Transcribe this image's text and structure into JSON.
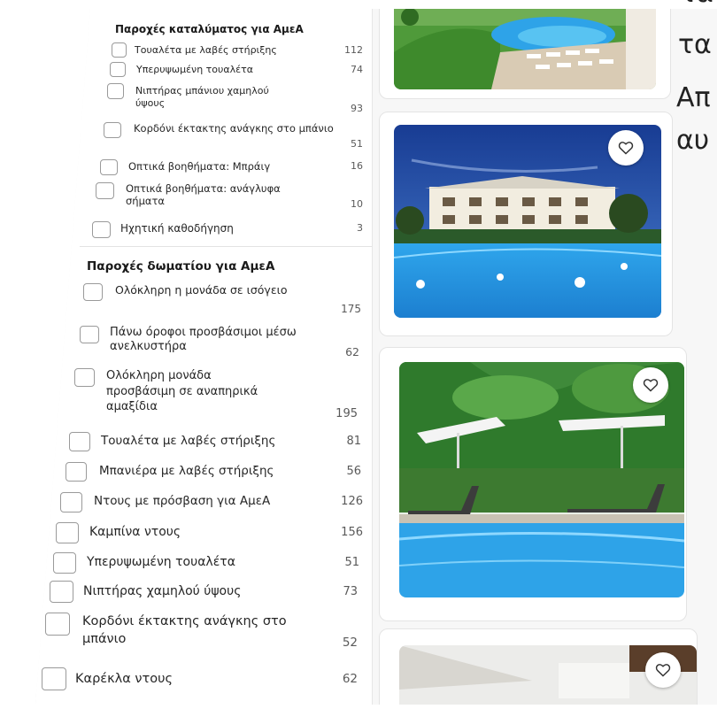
{
  "sections": [
    {
      "title": "Παροχές καταλύματος για ΑμεΑ",
      "items": [
        {
          "label": "Τουαλέτα με λαβές στήριξης",
          "count": "112"
        },
        {
          "label": "Υπερυψωμένη τουαλέτα",
          "count": "74"
        },
        {
          "label": "Νιπτήρας μπάνιου χαμηλού ύψους",
          "count": "93"
        },
        {
          "label": "Κορδόνι έκτακτης ανάγκης στο μπάνιο",
          "count": "51"
        },
        {
          "label": "Οπτικά βοηθήματα: Μπράιγ",
          "count": "16"
        },
        {
          "label": "Οπτικά βοηθήματα: ανάγλυφα σήματα",
          "count": "10"
        },
        {
          "label": "Ηχητική καθοδήγηση",
          "count": "3"
        }
      ]
    },
    {
      "title": "Παροχές δωματίου για ΑμεΑ",
      "items": [
        {
          "label": "Ολόκληρη η μονάδα σε ισόγειο",
          "count": "175"
        },
        {
          "label": "Πάνω όροφοι προσβάσιμοι μέσω ανελκυστήρα",
          "count": "62"
        },
        {
          "label": "Ολόκληρη μονάδα προσβάσιμη σε αναπηρικά αμαξίδια",
          "count": "195"
        },
        {
          "label": "Τουαλέτα με λαβές στήριξης",
          "count": "81"
        },
        {
          "label": "Μπανιέρα με λαβές στήριξης",
          "count": "56"
        },
        {
          "label": "Ντους με πρόσβαση για ΑμεΑ",
          "count": "126"
        },
        {
          "label": "Καμπίνα ντους",
          "count": "156"
        },
        {
          "label": "Υπερυψωμένη τουαλέτα",
          "count": "51"
        },
        {
          "label": "Νιπτήρας χαμηλού ύψους",
          "count": "73"
        },
        {
          "label": "Κορδόνι έκτακτης ανάγκης στο μπάνιο",
          "count": "52"
        },
        {
          "label": "Καρέκλα ντους",
          "count": "62"
        }
      ]
    }
  ],
  "right_fragments": {
    "line1": "τα",
    "line2": "Απ",
    "line3": "αυ"
  },
  "favorite_icon": "heart-icon",
  "colors": {
    "pool": "#2ea3e8",
    "lawn": "#4f9a3a",
    "sky": "#2350a8"
  }
}
